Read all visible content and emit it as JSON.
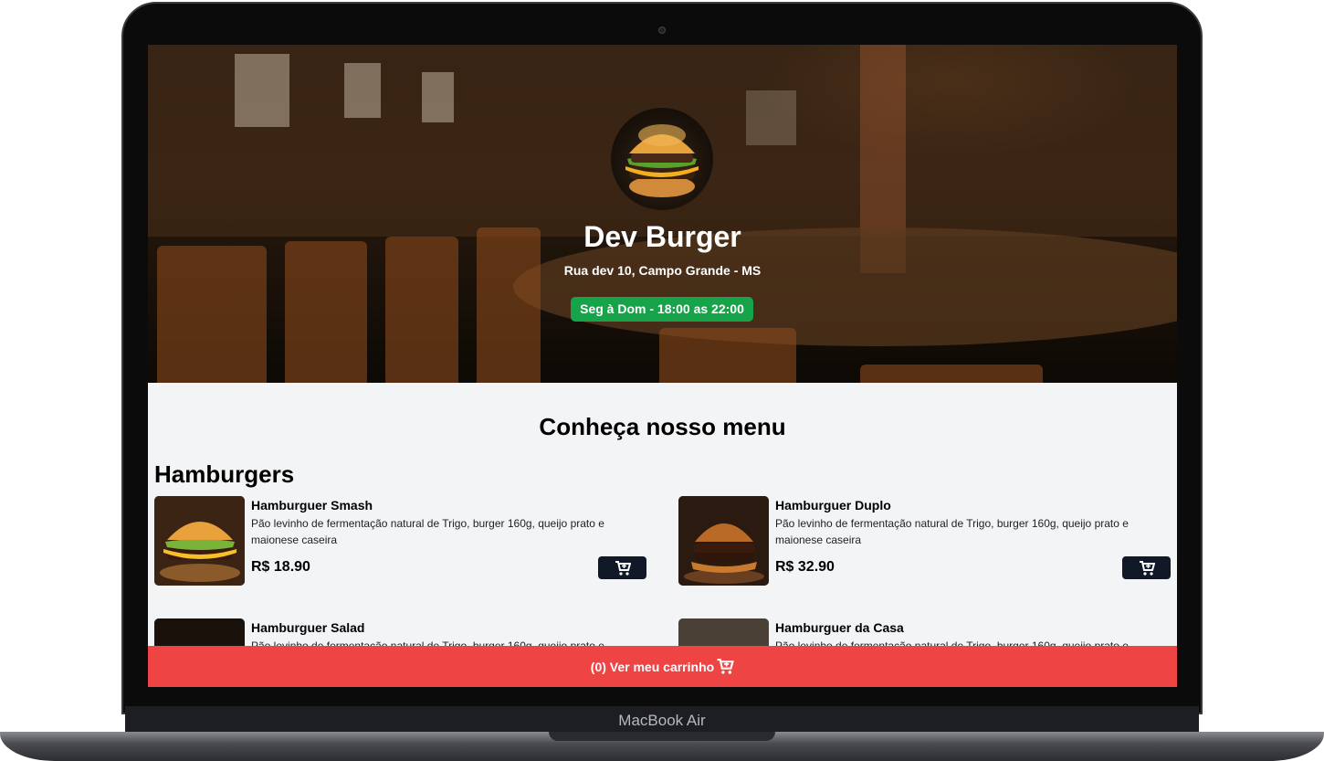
{
  "device": {
    "brand_label": "MacBook Air"
  },
  "hero": {
    "title": "Dev Burger",
    "address": "Rua dev 10, Campo Grande - MS",
    "hours": "Seg à Dom - 18:00 as 22:00",
    "hours_color": "#16a34a"
  },
  "menu": {
    "heading": "Conheça nosso menu",
    "category": "Hamburgers",
    "items": [
      {
        "name": "Hamburguer Smash",
        "description": "Pão levinho de fermentação natural de Trigo, burger 160g, queijo prato e maionese caseira",
        "price": "R$ 18.90",
        "cart_icon": "cart-plus-icon"
      },
      {
        "name": "Hamburguer Duplo",
        "description": "Pão levinho de fermentação natural de Trigo, burger 160g, queijo prato e maionese caseira",
        "price": "R$ 32.90",
        "cart_icon": "cart-plus-icon"
      },
      {
        "name": "Hamburguer Salad",
        "description": "Pão levinho de fermentação natural de Trigo, burger 160g, queijo prato e",
        "price": "",
        "cart_icon": "cart-plus-icon"
      },
      {
        "name": "Hamburguer da Casa",
        "description": "Pão levinho de fermentação natural de Trigo, burger 160g, queijo prato e",
        "price": "",
        "cart_icon": "cart-plus-icon"
      }
    ]
  },
  "cart_bar": {
    "label": "(0) Ver meu carrinho",
    "color": "#ef4444",
    "icon": "cart-icon"
  }
}
